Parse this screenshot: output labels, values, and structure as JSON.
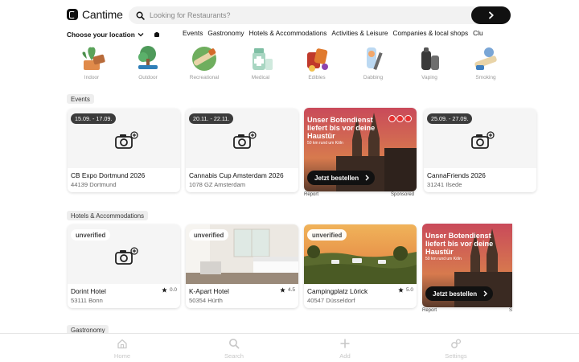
{
  "brand": {
    "name": "Cantime"
  },
  "search": {
    "placeholder": "Looking for Restaurants?"
  },
  "location": {
    "label": "Choose your location"
  },
  "nav": [
    "Events",
    "Gastronomy",
    "Hotels & Accommodations",
    "Activities & Leisure",
    "Companies & local shops",
    "Clu"
  ],
  "categories": [
    {
      "label": "Indoor",
      "icon": "indoor-plant-icon"
    },
    {
      "label": "Outdoor",
      "icon": "outdoor-tree-icon"
    },
    {
      "label": "Recreational",
      "icon": "joint-icon"
    },
    {
      "label": "Medical",
      "icon": "medical-bottle-icon"
    },
    {
      "label": "Edibles",
      "icon": "edibles-icon"
    },
    {
      "label": "Dabbing",
      "icon": "dabbing-icon"
    },
    {
      "label": "Vaping",
      "icon": "vape-icon"
    },
    {
      "label": "Smoking",
      "icon": "smoking-icon"
    }
  ],
  "sections": {
    "events": {
      "title": "Events",
      "cards": [
        {
          "badge": "15.09. - 17.09.",
          "title": "CB Expo Dortmund 2026",
          "address": "44139 Dortmund"
        },
        {
          "badge": "20.11. - 22.11.",
          "title": "Cannabis Cup Amsterdam 2026",
          "address": "1078 GZ Amsterdam"
        },
        {
          "badge": "25.09. - 27.09.",
          "title": "CannaFriends 2026",
          "address": "31241 Ilsede"
        }
      ],
      "ad": {
        "headline": "Unser Botendienst liefert bis vor deine Haustür",
        "small": "50 km rund um Köln",
        "button": "Jetzt bestellen",
        "report": "Report",
        "sponsored": "Sponsored"
      }
    },
    "hotels": {
      "title": "Hotels & Accommodations",
      "cards": [
        {
          "badge": "unverified",
          "title": "Dorint Hotel",
          "address": "53111 Bonn",
          "rating": "0.0"
        },
        {
          "badge": "unverified",
          "title": "K-Apart Hotel",
          "address": "50354 Hürth",
          "rating": "4.5"
        },
        {
          "badge": "unverified",
          "title": "Campingplatz Lörick",
          "address": "40547 Düsseldorf",
          "rating": "5.0"
        }
      ],
      "ad": {
        "headline": "Unser Botendienst liefert bis vor deine Haustür",
        "small": "50 km rund um Köln",
        "button": "Jetzt bestellen",
        "report": "Report",
        "sponsored": "S"
      }
    },
    "gastronomy": {
      "title": "Gastronomy"
    }
  },
  "bottom_nav": [
    {
      "label": "Home",
      "icon": "home-icon"
    },
    {
      "label": "Search",
      "icon": "search-icon"
    },
    {
      "label": "Add",
      "icon": "plus-icon"
    },
    {
      "label": "Settings",
      "icon": "settings-icon"
    }
  ]
}
